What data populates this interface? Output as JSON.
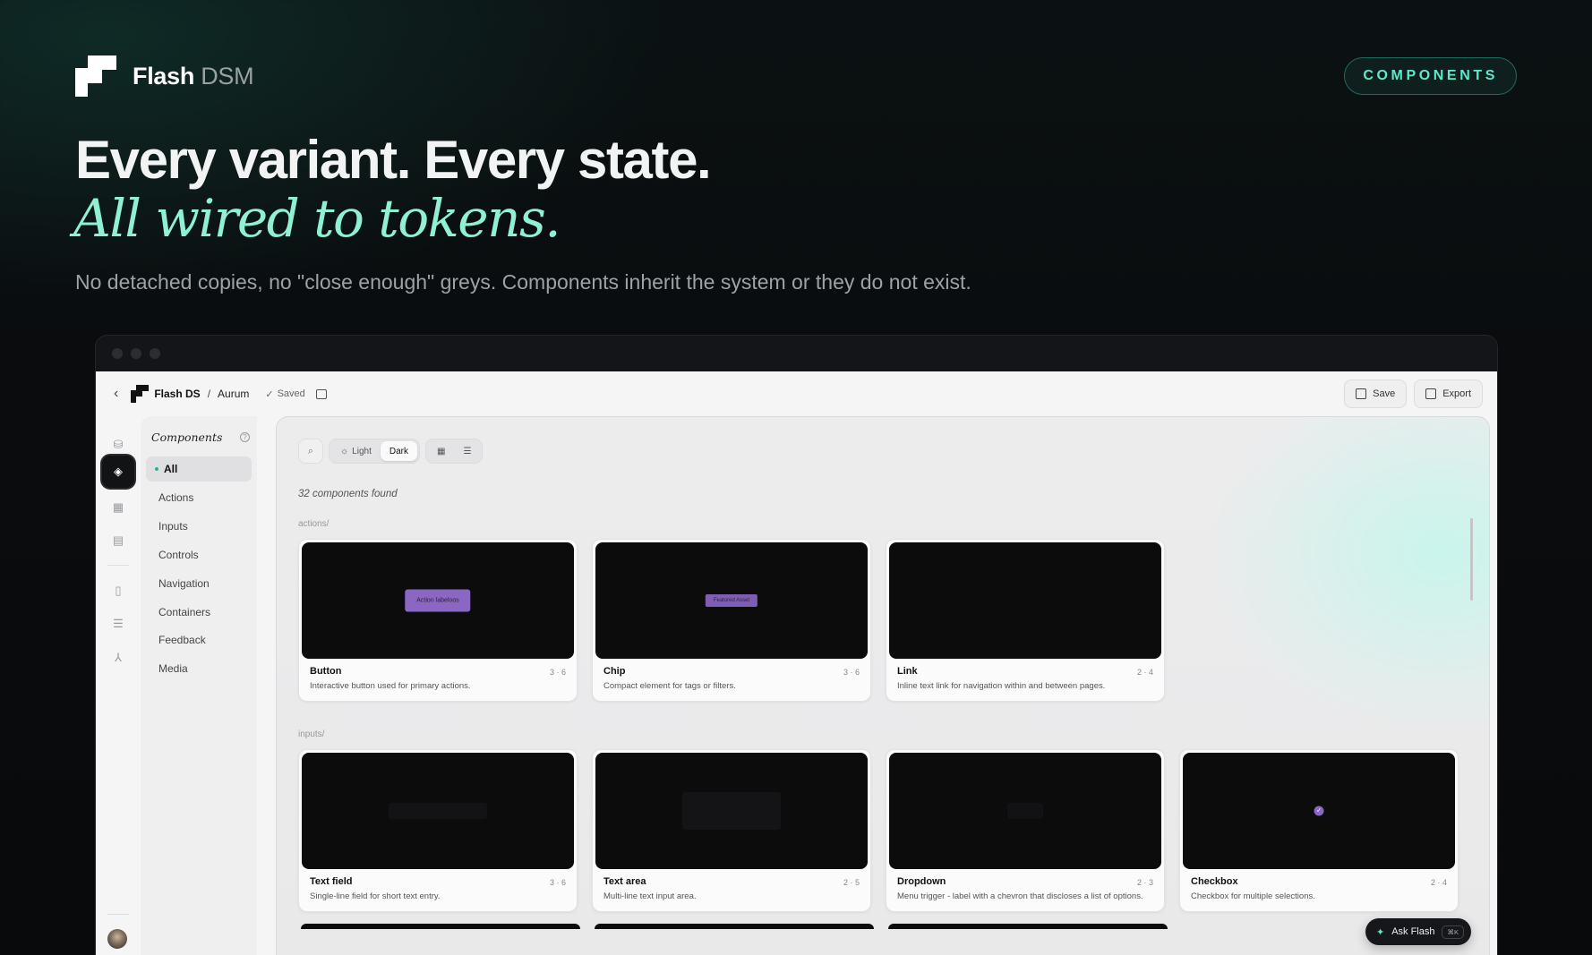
{
  "brand": {
    "name": "Flash",
    "suffix": "DSM"
  },
  "badge": "COMPONENTS",
  "hero": {
    "title": "Every variant. Every state.",
    "subtitle": "All wired to tokens.",
    "description": "No detached copies, no \"close enough\" greys. Components inherit the system or they do not exist."
  },
  "app": {
    "breadcrumb": {
      "workspace": "Flash DS",
      "separator": "/",
      "project": "Aurum"
    },
    "saved_label": "Saved",
    "save_label": "Save",
    "export_label": "Export",
    "nav": {
      "heading": "Components",
      "items": [
        {
          "label": "All",
          "active": true
        },
        {
          "label": "Actions"
        },
        {
          "label": "Inputs"
        },
        {
          "label": "Controls"
        },
        {
          "label": "Navigation"
        },
        {
          "label": "Containers"
        },
        {
          "label": "Feedback"
        },
        {
          "label": "Media"
        }
      ]
    },
    "rail_icons": [
      "stack-icon",
      "components-icon",
      "grid-icon",
      "layout-icon",
      "document-icon",
      "list-icon",
      "tree-icon",
      "settings-icon"
    ],
    "toolbar": {
      "light_label": "Light",
      "dark_label": "Dark",
      "selected_theme": "Dark"
    },
    "count_label": "32 components found",
    "groups": [
      {
        "label": "actions/",
        "cards": [
          {
            "title": "Button",
            "meta": "3 · 6",
            "desc": "Interactive button used for primary actions.",
            "preview_text": "Action labeloos"
          },
          {
            "title": "Chip",
            "meta": "3 · 6",
            "desc": "Compact element for tags or filters.",
            "preview_text": "Featured Asset"
          },
          {
            "title": "Link",
            "meta": "2 · 4",
            "desc": "Inline text link for navigation within and between pages.",
            "preview_text": ""
          }
        ]
      },
      {
        "label": "inputs/",
        "cards": [
          {
            "title": "Text field",
            "meta": "3 · 6",
            "desc": "Single-line field for short text entry."
          },
          {
            "title": "Text area",
            "meta": "2 · 5",
            "desc": "Multi-line text input area."
          },
          {
            "title": "Dropdown",
            "meta": "2 · 3",
            "desc": "Menu trigger - label with a chevron that discloses a list of options."
          },
          {
            "title": "Checkbox",
            "meta": "2 · 4",
            "desc": "Checkbox for multiple selections."
          }
        ]
      }
    ],
    "ask": {
      "label": "Ask Flash",
      "shortcut": "⌘K"
    },
    "colors": {
      "accent": "#5ee8cc",
      "preview_bg": "#0c0c0d",
      "purple": "#8a67c2"
    }
  }
}
